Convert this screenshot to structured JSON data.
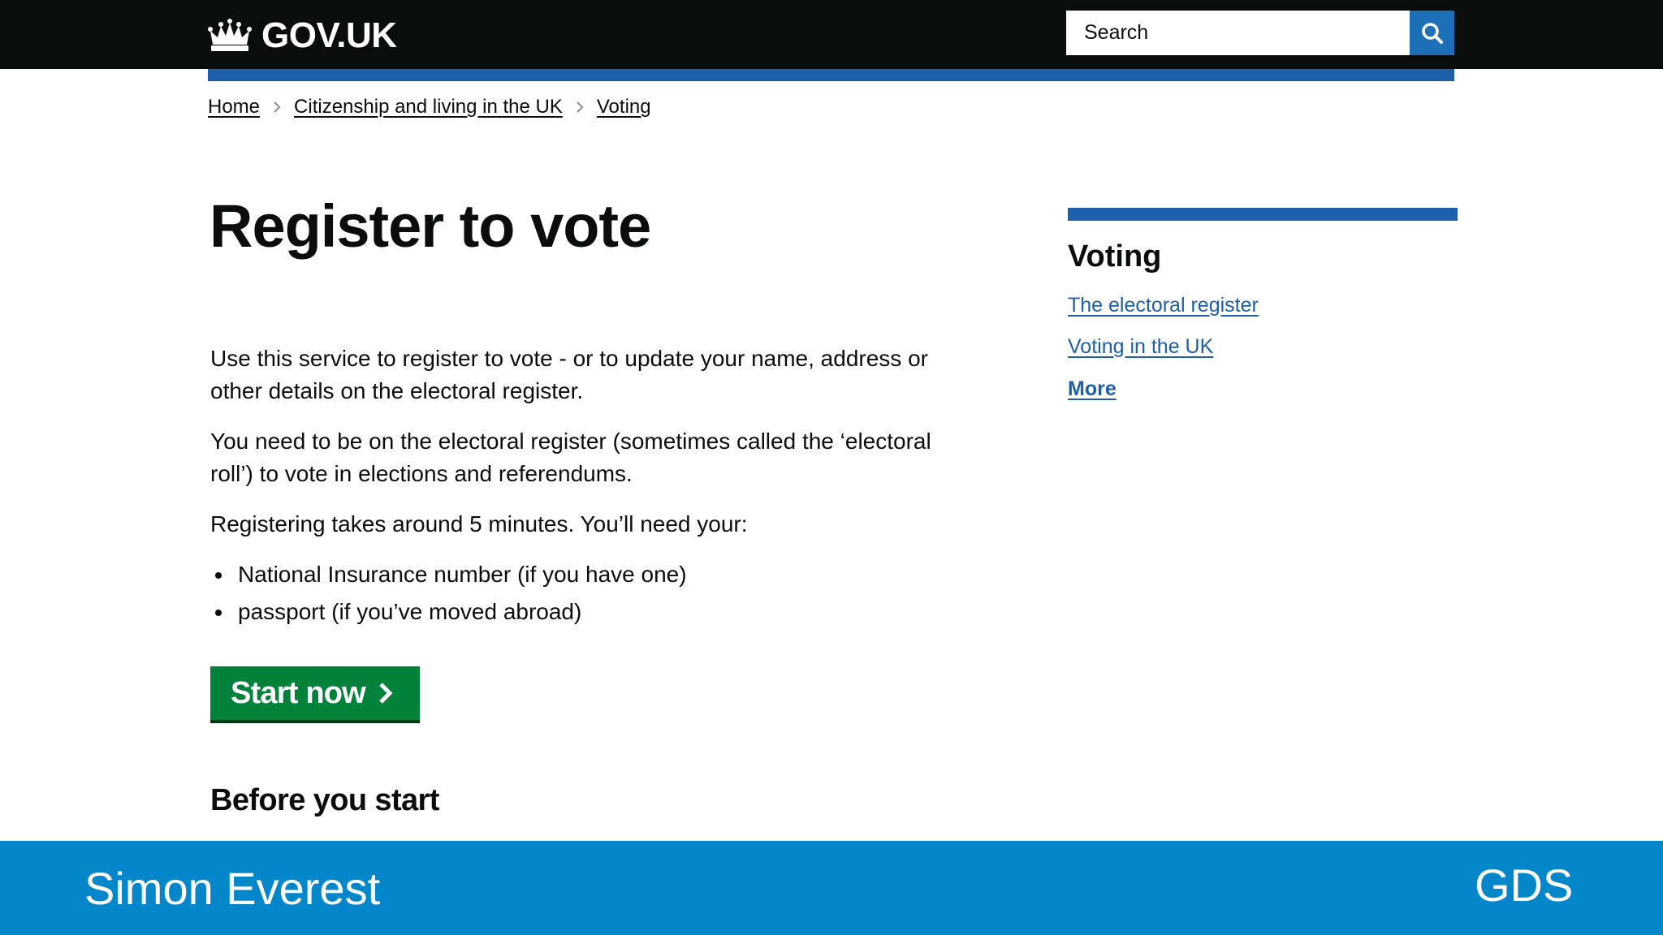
{
  "header": {
    "logo_text": "GOV.UK",
    "search_placeholder": "Search",
    "search_button_label": "Search"
  },
  "breadcrumb": [
    "Home",
    "Citizenship and living in the UK",
    "Voting"
  ],
  "main": {
    "title": "Register to vote",
    "paragraphs": [
      "Use this service to register to vote - or to update your name, address or other details on the electoral register.",
      "You need to be on the electoral register (sometimes called the ‘electoral roll’) to vote in elections and referendums.",
      "Registering takes around 5 minutes. You’ll need your:"
    ],
    "bullets": [
      "National Insurance number (if you have one)",
      "passport (if you’ve moved abroad)"
    ],
    "start_button_label": "Start now",
    "subheading": "Before you start"
  },
  "related": {
    "title": "Voting",
    "links": [
      "The electoral register",
      "Voting in the UK",
      "More"
    ]
  },
  "footer": {
    "speaker": "Simon Everest",
    "organisation": "GDS"
  },
  "colors": {
    "header_bg": "#0b0c0c",
    "brand_blue": "#1d5fa8",
    "search_button": "#1d70b8",
    "start_green": "#00823b",
    "footer_band": "#0387ca"
  },
  "icons": {
    "logo": "crown-icon",
    "search": "search-icon",
    "breadcrumb_separator": "chevron-right-icon",
    "start_button": "chevron-right-icon"
  }
}
